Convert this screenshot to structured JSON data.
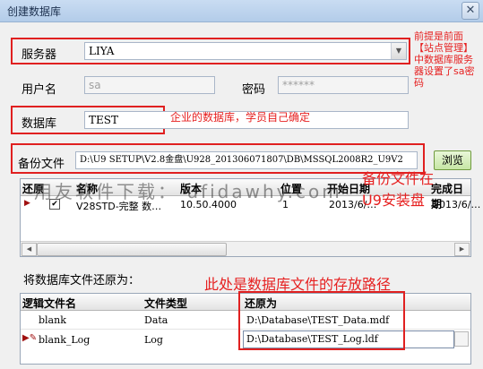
{
  "window": {
    "title": "创建数据库",
    "close": "✕"
  },
  "server": {
    "label": "服务器",
    "value": "LIYA",
    "dropdown_arrow": "▼"
  },
  "user": {
    "label": "用户名",
    "value": "sa"
  },
  "password": {
    "label": "密码",
    "value": "******"
  },
  "database": {
    "label": "数据库",
    "value": "TEST"
  },
  "backup": {
    "label": "备份文件",
    "value": "D:\\U9  SETUP\\V2.8金盘\\U928_20130607180​7\\DB\\MSSQL2008R2_U9V2",
    "browse_label": "浏览"
  },
  "restore_grid": {
    "headers": [
      "还原",
      "名称",
      "版本",
      "位置",
      "开始日期",
      "完成日期"
    ],
    "rows": [
      {
        "marker": "▶",
        "checked": "✔",
        "name": "V28STD-完整 数…",
        "version": "10.50.4000",
        "position": "1",
        "start": "2013/6/…",
        "finish": "2013/6/…"
      }
    ]
  },
  "restore_as": {
    "label": "将数据库文件还原为："
  },
  "file_grid": {
    "headers": [
      "逻辑文件名",
      "文件类型",
      "还原为"
    ],
    "rows": [
      {
        "marker": "",
        "logical": "blank",
        "type": "Data",
        "restore_to": "D:\\Database\\TEST_Data.mdf"
      },
      {
        "marker": "▶✎",
        "logical": "blank_Log",
        "type": "Log",
        "restore_to": "D:\\Database\\TEST_Log.ldf"
      }
    ]
  },
  "annotations": {
    "server_note": "前提是前面【站点管理】中数据库服务器设置了sa密码",
    "db_note": "企业的数据库，学员自己确定",
    "backup_note": "备份文件在U9安装盘",
    "path_note": "此处是数据库文件的存放路径"
  },
  "watermark": "用友软件下载： ufidawhy.com",
  "colors": {
    "annotation": "#e62020",
    "titlebar": "#b3cce9"
  }
}
